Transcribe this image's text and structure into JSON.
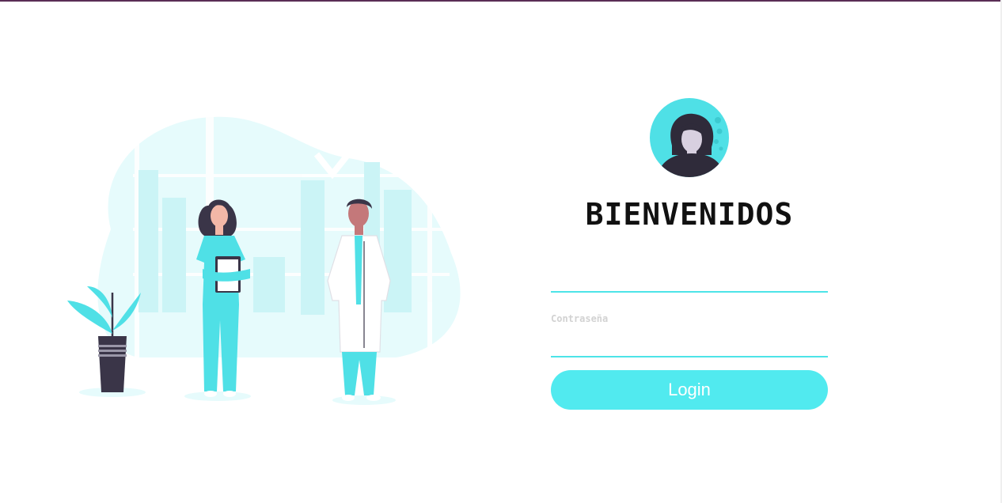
{
  "login": {
    "title": "BIENVENIDOS",
    "username_value": "",
    "password_label": "Contraseña",
    "password_value": "",
    "button_label": "Login"
  },
  "colors": {
    "accent": "#51eaef",
    "underline": "#4de4e8",
    "illustration_bg": "#e6fbfc",
    "dark": "#3a3548"
  },
  "icons": {
    "avatar": "woman-avatar-icon",
    "illustration": "medical-staff-illustration"
  }
}
